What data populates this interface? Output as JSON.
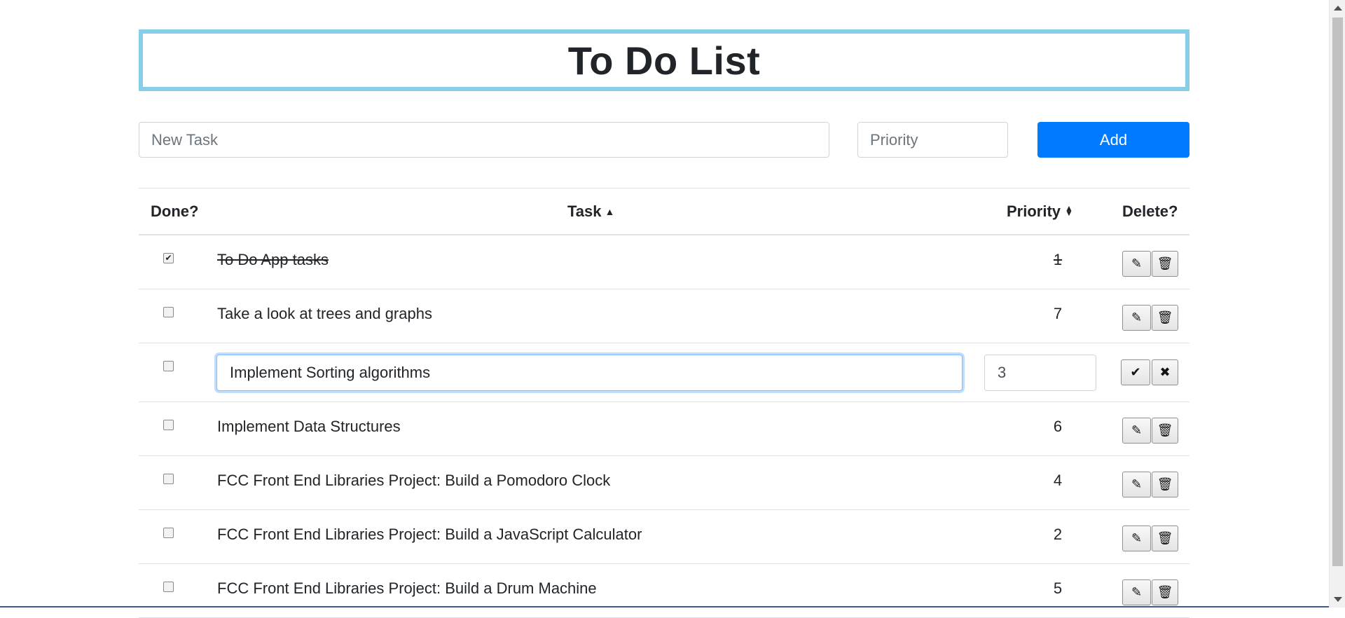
{
  "header": {
    "title": "To Do List"
  },
  "new_task": {
    "placeholder": "New Task",
    "value": ""
  },
  "priority_input": {
    "placeholder": "Priority",
    "value": ""
  },
  "add_button": {
    "label": "Add"
  },
  "table": {
    "headers": {
      "done": "Done?",
      "task": "Task",
      "task_sort": "▲",
      "priority": "Priority",
      "delete": "Delete?"
    },
    "rows": [
      {
        "done": true,
        "checkmark": "✔",
        "task": "To Do App tasks",
        "priority": "1",
        "edit_icon": "✎",
        "delete_icon": "🗑"
      },
      {
        "done": false,
        "checkmark": "",
        "task": "Take a look at trees and graphs",
        "priority": "7",
        "edit_icon": "✎",
        "delete_icon": "🗑"
      },
      {
        "done": false,
        "checkmark": "",
        "editing": true,
        "task": "Implement Sorting algorithms",
        "priority": "3",
        "save_icon": "✔",
        "cancel_icon": "✖"
      },
      {
        "done": false,
        "checkmark": "",
        "task": "Implement Data Structures",
        "priority": "6",
        "edit_icon": "✎",
        "delete_icon": "🗑"
      },
      {
        "done": false,
        "checkmark": "",
        "task": "FCC Front End Libraries Project: Build a Pomodoro Clock",
        "priority": "4",
        "edit_icon": "✎",
        "delete_icon": "🗑"
      },
      {
        "done": false,
        "checkmark": "",
        "task": "FCC Front End Libraries Project: Build a JavaScript Calculator",
        "priority": "2",
        "edit_icon": "✎",
        "delete_icon": "🗑"
      },
      {
        "done": false,
        "checkmark": "",
        "task": "FCC Front End Libraries Project: Build a Drum Machine",
        "priority": "5",
        "edit_icon": "✎",
        "delete_icon": "🗑"
      }
    ]
  },
  "colors": {
    "title_border": "#87ceeb",
    "add_button": "#007bff"
  }
}
